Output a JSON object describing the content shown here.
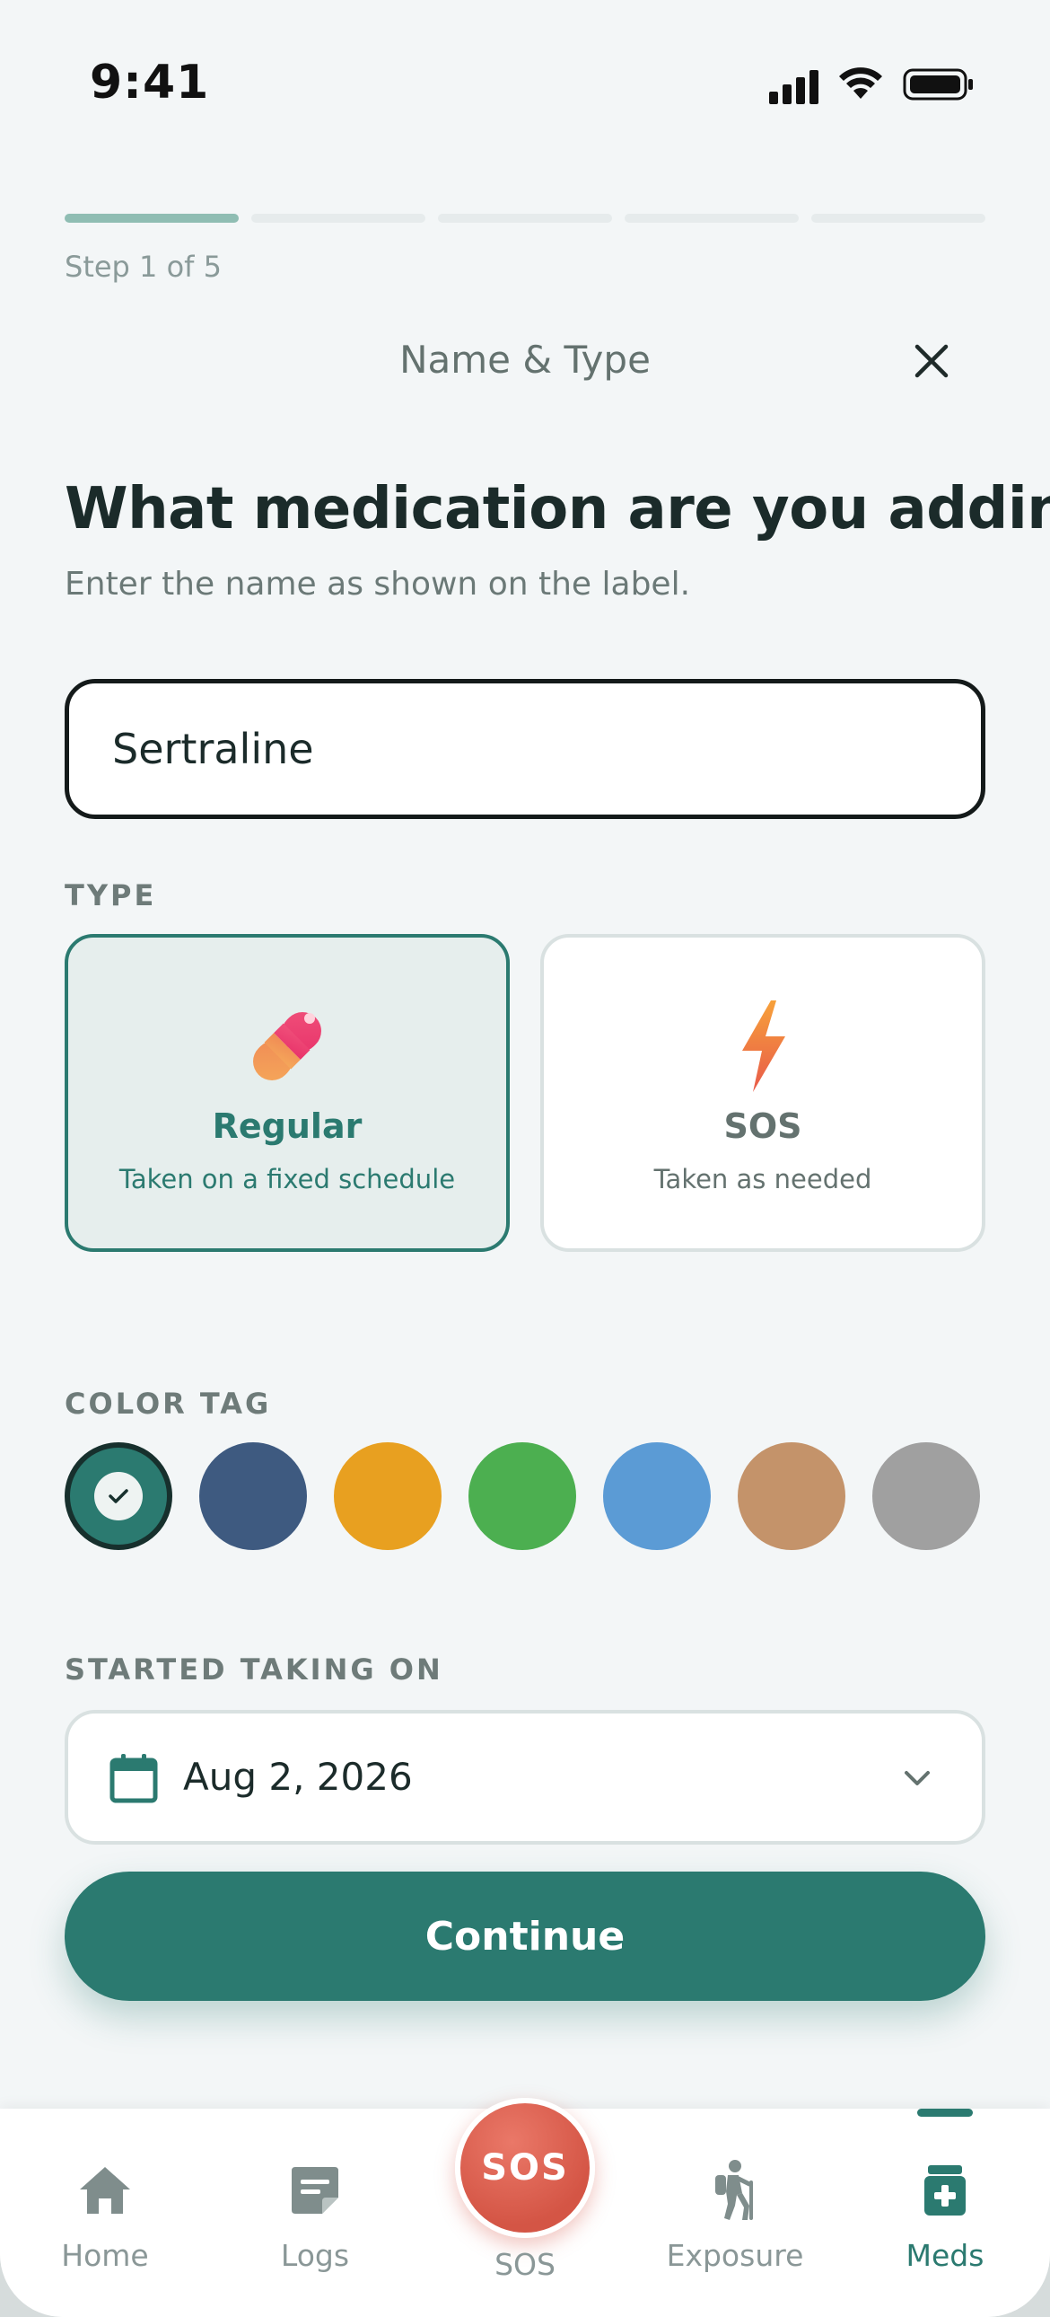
{
  "status_bar": {
    "time": "9:41"
  },
  "progress": {
    "total_steps": 5,
    "current_step": 1,
    "step_label": "Step 1 of 5"
  },
  "header": {
    "title": "Name & Type",
    "close_icon": "close-icon"
  },
  "question": {
    "title": "What medication are you adding?",
    "hint": "Enter the name as shown on the label."
  },
  "name_input": {
    "value": "Sertraline",
    "placeholder": ""
  },
  "type_section": {
    "label": "TYPE",
    "options": [
      {
        "title": "Regular",
        "subtitle": "Taken on a fixed schedule",
        "icon": "pill-icon",
        "selected": true
      },
      {
        "title": "SOS",
        "subtitle": "Taken as needed",
        "icon": "lightning-icon",
        "selected": false
      }
    ]
  },
  "color_tag": {
    "label": "COLOR TAG",
    "colors": [
      "#2b7a70",
      "#3e5a80",
      "#e8a020",
      "#4caf50",
      "#5b9bd5",
      "#c4936a",
      "#a0a0a0"
    ],
    "selected_index": 0
  },
  "start_date": {
    "label": "STARTED TAKING ON",
    "value": "Aug 2, 2026"
  },
  "continue": {
    "label": "Continue"
  },
  "tabbar": {
    "tabs": [
      {
        "label": "Home",
        "icon": "home-icon"
      },
      {
        "label": "Logs",
        "icon": "notes-icon"
      },
      {
        "label": "SOS",
        "icon": "sos-button"
      },
      {
        "label": "Exposure",
        "icon": "hiker-icon"
      },
      {
        "label": "Meds",
        "icon": "medicine-icon"
      }
    ],
    "sos_button_text": "SOS",
    "active_tab": "Meds"
  },
  "colors": {
    "accent": "#2b7a70",
    "sos": "#d85a4a"
  }
}
